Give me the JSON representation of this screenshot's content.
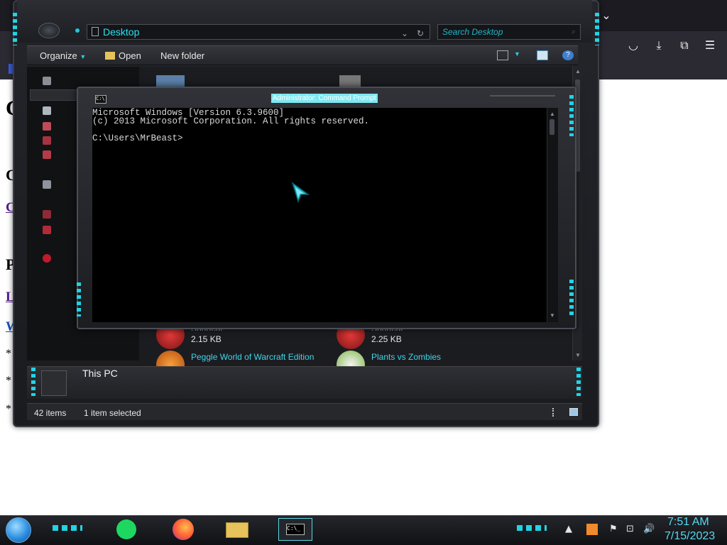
{
  "browser": {
    "page_letters": [
      "C",
      "C",
      "P"
    ],
    "page_links": [
      "C",
      "L",
      "W"
    ],
    "page_stars": [
      "*",
      "*",
      "*"
    ],
    "icons": [
      "pocket-icon",
      "download-icon",
      "extensions-icon",
      "menu-icon",
      "chevron-down-icon"
    ]
  },
  "explorer": {
    "address": "Desktop",
    "search_placeholder": "Search Desktop",
    "toolbar": {
      "organize": "Organize",
      "open": "Open",
      "new_folder": "New folder"
    },
    "files": [
      {
        "name": "",
        "size": "2.15 KB",
        "type": "Shortcut"
      },
      {
        "name": "",
        "size": "2.25 KB",
        "type": "Shortcut"
      },
      {
        "name": "Peggle World of Warcraft Edition"
      },
      {
        "name": "Plants vs Zombies"
      }
    ],
    "details_name": "This PC",
    "status": {
      "items": "42 items",
      "selected": "1 item selected"
    }
  },
  "cmd": {
    "title": "Administrator: Command Prompt",
    "lines": [
      "Microsoft Windows [Version 6.3.9600]",
      "(c) 2013 Microsoft Corporation. All rights reserved.",
      "",
      "C:\\Users\\MrBeast>"
    ]
  },
  "taskbar": {
    "apps": [
      "spotify-icon",
      "firefox-icon",
      "file-explorer-icon",
      "command-prompt-icon"
    ],
    "time": "7:51 AM",
    "date": "7/15/2023"
  },
  "colors": {
    "accent": "#22d3e4",
    "clock": "#57d9f0",
    "link": "#551a8b"
  }
}
